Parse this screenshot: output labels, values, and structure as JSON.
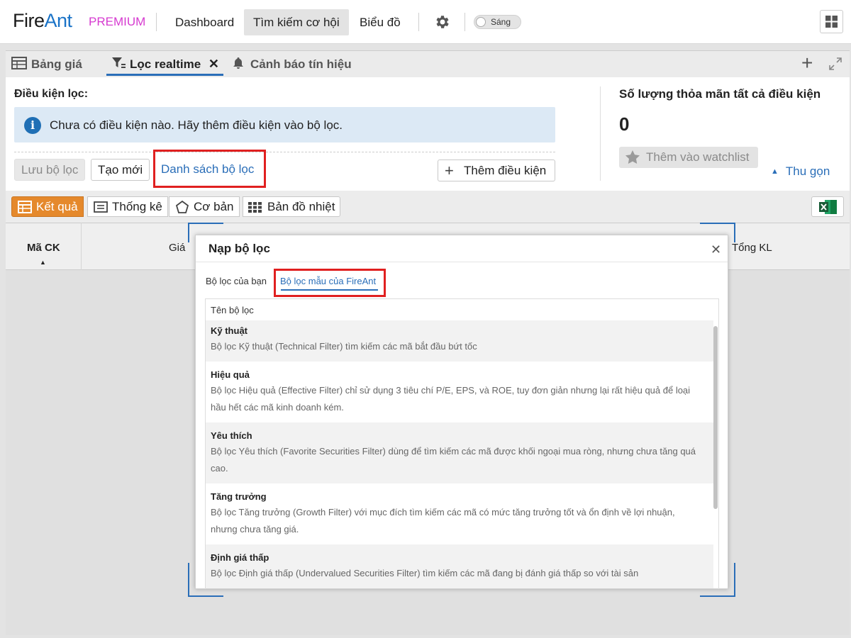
{
  "brand": {
    "name_part1": "Fire",
    "name_part2": "Ant",
    "tier": "PREMIUM"
  },
  "nav": {
    "items": [
      {
        "label": "Dashboard"
      },
      {
        "label": "Tìm kiếm cơ hội",
        "active": true
      },
      {
        "label": "Biểu đồ"
      }
    ],
    "theme_toggle_label": "Sáng"
  },
  "tabs": [
    {
      "label": "Bảng giá",
      "icon": "table-icon"
    },
    {
      "label": "Lọc realtime",
      "icon": "filter-icon",
      "active": true
    },
    {
      "label": "Cảnh báo tín hiệu",
      "icon": "bell-icon"
    }
  ],
  "filter": {
    "heading": "Điều kiện lọc:",
    "info_message": "Chưa có điều kiện nào. Hãy thêm điều kiện vào bộ lọc.",
    "save_label": "Lưu bộ lọc",
    "new_label": "Tạo mới",
    "list_label": "Danh sách bộ lọc",
    "add_condition_label": "Thêm điều kiện"
  },
  "summary": {
    "heading": "Số lượng thỏa mãn tất cả điều kiện",
    "count": "0",
    "watchlist_label": "Thêm vào watchlist",
    "collapse_label": "Thu gọn"
  },
  "result_tabs": [
    {
      "label": "Kết quả",
      "active": true,
      "icon": "list-icon"
    },
    {
      "label": "Thống kê",
      "icon": "stats-icon"
    },
    {
      "label": "Cơ bản",
      "icon": "pentagon-icon"
    },
    {
      "label": "Bản đồ nhiệt",
      "icon": "heatmap-icon"
    }
  ],
  "table": {
    "columns": [
      "Mã CK",
      "Giá",
      "Tổng KL"
    ]
  },
  "modal": {
    "title": "Nạp bộ lọc",
    "tabs": [
      {
        "label": "Bộ lọc của bạn"
      },
      {
        "label": "Bộ lọc mẫu của FireAnt",
        "active": true
      }
    ],
    "column_header": "Tên bộ lọc",
    "filters": [
      {
        "name": "Kỹ thuật",
        "desc1": "Bộ lọc Kỹ thuật (Technical Filter) tìm kiếm các mã bắt đầu bứt tốc",
        "desc2": ""
      },
      {
        "name": "Hiệu quả",
        "desc1": "Bộ lọc Hiệu quả (Effective Filter) chỉ sử dụng 3 tiêu chí P/E, EPS, và ROE, tuy đơn giản nhưng lại rất hiệu quả để loại",
        "desc2": "hầu hết các mã kinh doanh kém."
      },
      {
        "name": "Yêu thích",
        "desc1": "Bộ lọc Yêu thích (Favorite Securities Filter) dùng để tìm kiếm các mã được khối ngoại mua ròng, nhưng chưa tăng quá",
        "desc2": "cao."
      },
      {
        "name": "Tăng trưởng",
        "desc1": "Bộ lọc Tăng trưởng (Growth Filter) với mục đích tìm kiếm các mã có mức tăng trưởng tốt và ổn định về lợi nhuận,",
        "desc2": "nhưng chưa tăng giá."
      },
      {
        "name": "Định giá thấp",
        "desc1": "Bộ lọc Định giá thấp (Undervalued Securities Filter) tìm kiếm các mã đang bị đánh giá thấp so với tài sản",
        "desc2": ""
      }
    ]
  },
  "colors": {
    "accent": "#2a6eb8",
    "brand_ant": "#1a73c7",
    "premium": "#d63ad0",
    "result_active": "#e5892c",
    "highlight": "#e02020"
  }
}
